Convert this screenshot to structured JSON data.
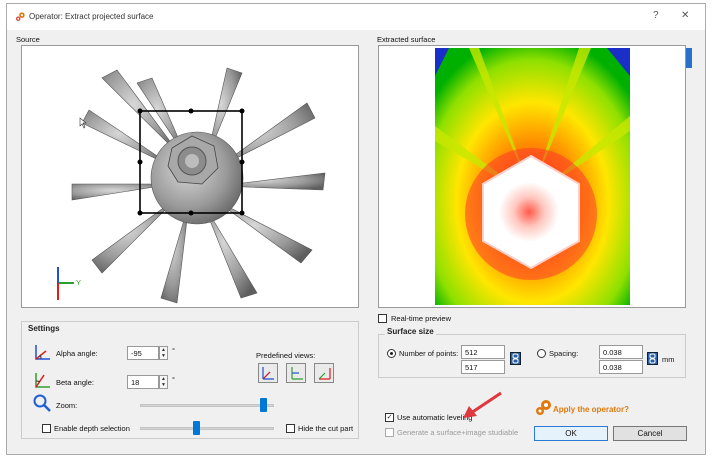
{
  "window": {
    "title": "Operator: Extract projected surface",
    "help": "?",
    "close": "✕"
  },
  "source": {
    "label": "Source",
    "axis_y": "Y"
  },
  "extracted": {
    "label": "Extracted surface"
  },
  "preview": {
    "label": "Real-time preview",
    "checked": false
  },
  "settings": {
    "title": "Settings",
    "alpha_label": "Alpha angle:",
    "alpha_value": "-95",
    "beta_label": "Beta angle:",
    "beta_value": "18",
    "degree": "°",
    "zoom_label": "Zoom:",
    "zoom_level": 0.92,
    "depth_label": "Enable depth selection",
    "depth_level": 0.42,
    "hide_label": "Hide the cut part",
    "predefined_label": "Predefined views:"
  },
  "surface_size": {
    "title": "Surface size",
    "points_label": "Number of points:",
    "points_x": "512",
    "points_y": "517",
    "spacing_label": "Spacing:",
    "spacing_x": "0.038",
    "spacing_y": "0.038",
    "unit": "mm"
  },
  "leveling": {
    "label": "Use automatic leveling",
    "checked": true
  },
  "studiable": {
    "label": "Generate a surface+image studiable"
  },
  "apply": {
    "label": "Apply the operator?"
  },
  "buttons": {
    "ok": "OK",
    "cancel": "Cancel"
  },
  "colors": {
    "accent": "#e07a10",
    "arrow": "#e0373f",
    "selection": "#0078d7"
  }
}
